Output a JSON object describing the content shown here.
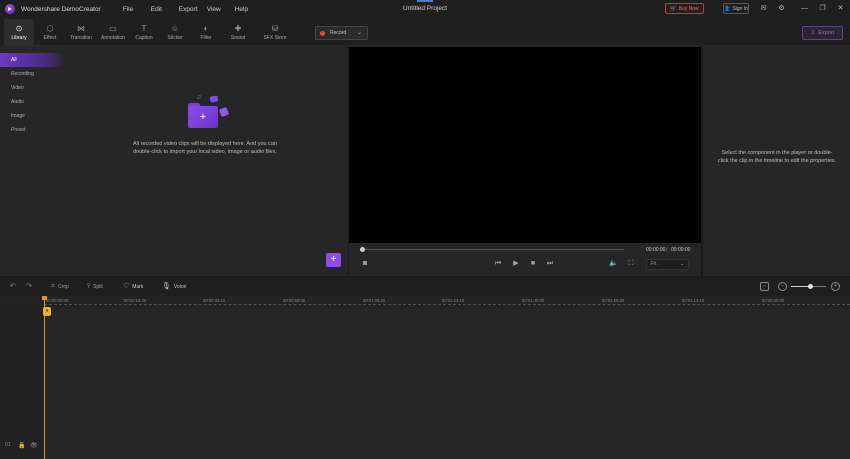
{
  "titlebar": {
    "app_name": "Wondershare DemoCreator",
    "menu": [
      "File",
      "Edit",
      "Export",
      "View",
      "Help"
    ],
    "project_title": "Untitled Project",
    "buy_now": "Buy Now",
    "sign_in": "Sign In"
  },
  "toolbar": {
    "tools": [
      {
        "label": "Library",
        "icon": "library-icon"
      },
      {
        "label": "Effect",
        "icon": "effect-icon"
      },
      {
        "label": "Transition",
        "icon": "transition-icon"
      },
      {
        "label": "Annotation",
        "icon": "annotation-icon"
      },
      {
        "label": "Caption",
        "icon": "caption-icon"
      },
      {
        "label": "Sticker",
        "icon": "sticker-icon"
      },
      {
        "label": "Filter",
        "icon": "filter-icon"
      },
      {
        "label": "Sound",
        "icon": "sound-icon"
      },
      {
        "label": "SFX Store",
        "icon": "sfx-store-icon"
      }
    ],
    "record_label": "Record",
    "export_label": "Export"
  },
  "library": {
    "categories": [
      "All",
      "Recording",
      "Video",
      "Audio",
      "Image",
      "Preset"
    ],
    "empty_message": "All recorded video clips will be displayed here. And you can double-click to import your local video, image or audio files."
  },
  "preview": {
    "current_time": "00:00:00",
    "total_time": "00:00:00",
    "quality": "Fit"
  },
  "properties": {
    "hint": "Select the component in the player or double-click the clip in the timeline to edit the properties."
  },
  "timeline": {
    "tools": {
      "crop": "Crop",
      "split": "Split",
      "mark": "Mark",
      "voice": "Voice"
    },
    "ruler": [
      "00:00:00:00",
      "00:00:16:20",
      "00:00:33:10",
      "00:00:50:00",
      "00:01:06:20",
      "00:01:23:10",
      "00:01:40:00",
      "00:01:56:20",
      "00:02:13:10",
      "00:02:30:00"
    ],
    "track_number": "01",
    "zoom_level": 0.57
  },
  "colors": {
    "accent": "#8b4ee8",
    "playhead": "#d9962a",
    "record": "#e0484b"
  }
}
